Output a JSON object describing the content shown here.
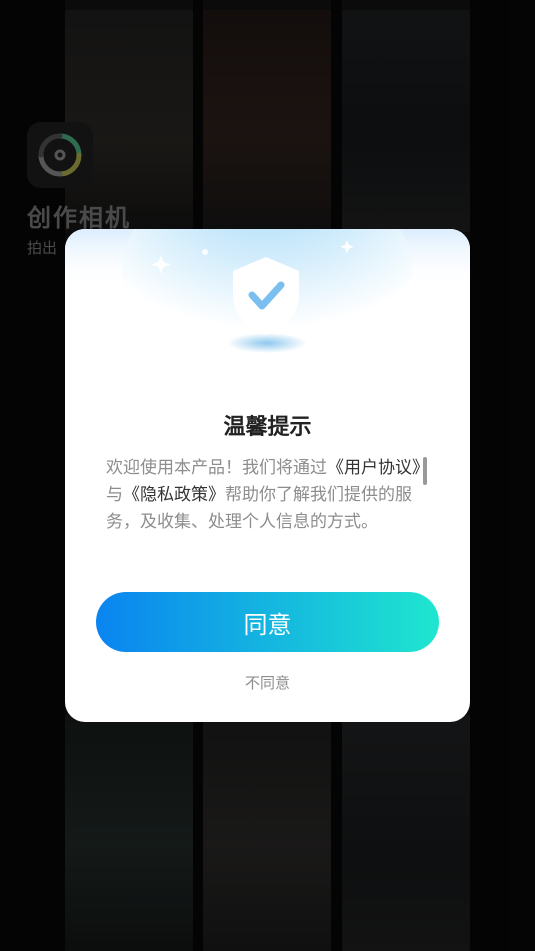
{
  "app": {
    "name": "创作相机",
    "slogan": "拍出"
  },
  "dialog": {
    "title": "温馨提示",
    "body_prefix": "欢迎使用本产品！我们将通过",
    "user_agreement_link": "《用户协议》",
    "connector": "与",
    "privacy_policy_link": "《隐私政策》",
    "body_suffix": "帮助你了解我们提供的服务，及收集、处理个人信息的方式。",
    "agree_label": "同意",
    "disagree_label": "不同意"
  },
  "icons": {
    "hero": "shield-check-icon",
    "logo": "camera-lens-icon"
  },
  "colors": {
    "button_start": "#0a84f0",
    "button_end": "#1fe6cf",
    "link_text": "#333333",
    "body_text": "#8d8d8d"
  }
}
